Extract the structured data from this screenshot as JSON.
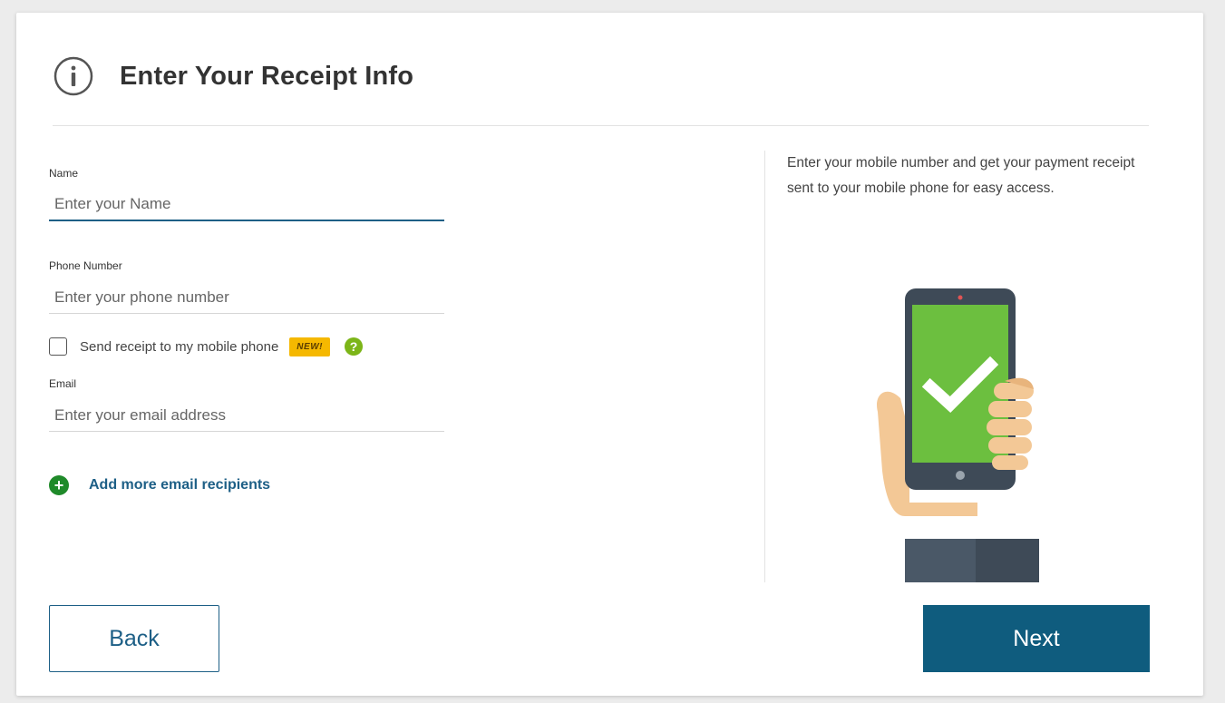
{
  "header": {
    "title": "Enter Your Receipt Info",
    "icon": "info-circle-icon"
  },
  "form": {
    "name": {
      "label": "Name",
      "placeholder": "Enter your Name",
      "value": ""
    },
    "phone": {
      "label": "Phone Number",
      "placeholder": "Enter your phone number",
      "value": ""
    },
    "sms_checkbox": {
      "label": "Send receipt to my mobile phone",
      "checked": false,
      "badge": "NEW!",
      "help_icon": "question-icon"
    },
    "email": {
      "label": "Email",
      "placeholder": "Enter your email address",
      "value": ""
    },
    "add_more": {
      "label": "Add more email recipients",
      "icon": "plus-icon"
    }
  },
  "side_panel": {
    "description": "Enter your mobile number and get your payment receipt sent to your mobile phone for easy access.",
    "illustration": "phone-checkmark-illustration"
  },
  "buttons": {
    "back": "Back",
    "next": "Next"
  },
  "colors": {
    "primary": "#0f5c7e",
    "link": "#1d5f86",
    "add_icon": "#1f8a2a",
    "help_icon": "#7cb518",
    "badge": "#f5b800",
    "phone_screen": "#6cbf3f"
  }
}
